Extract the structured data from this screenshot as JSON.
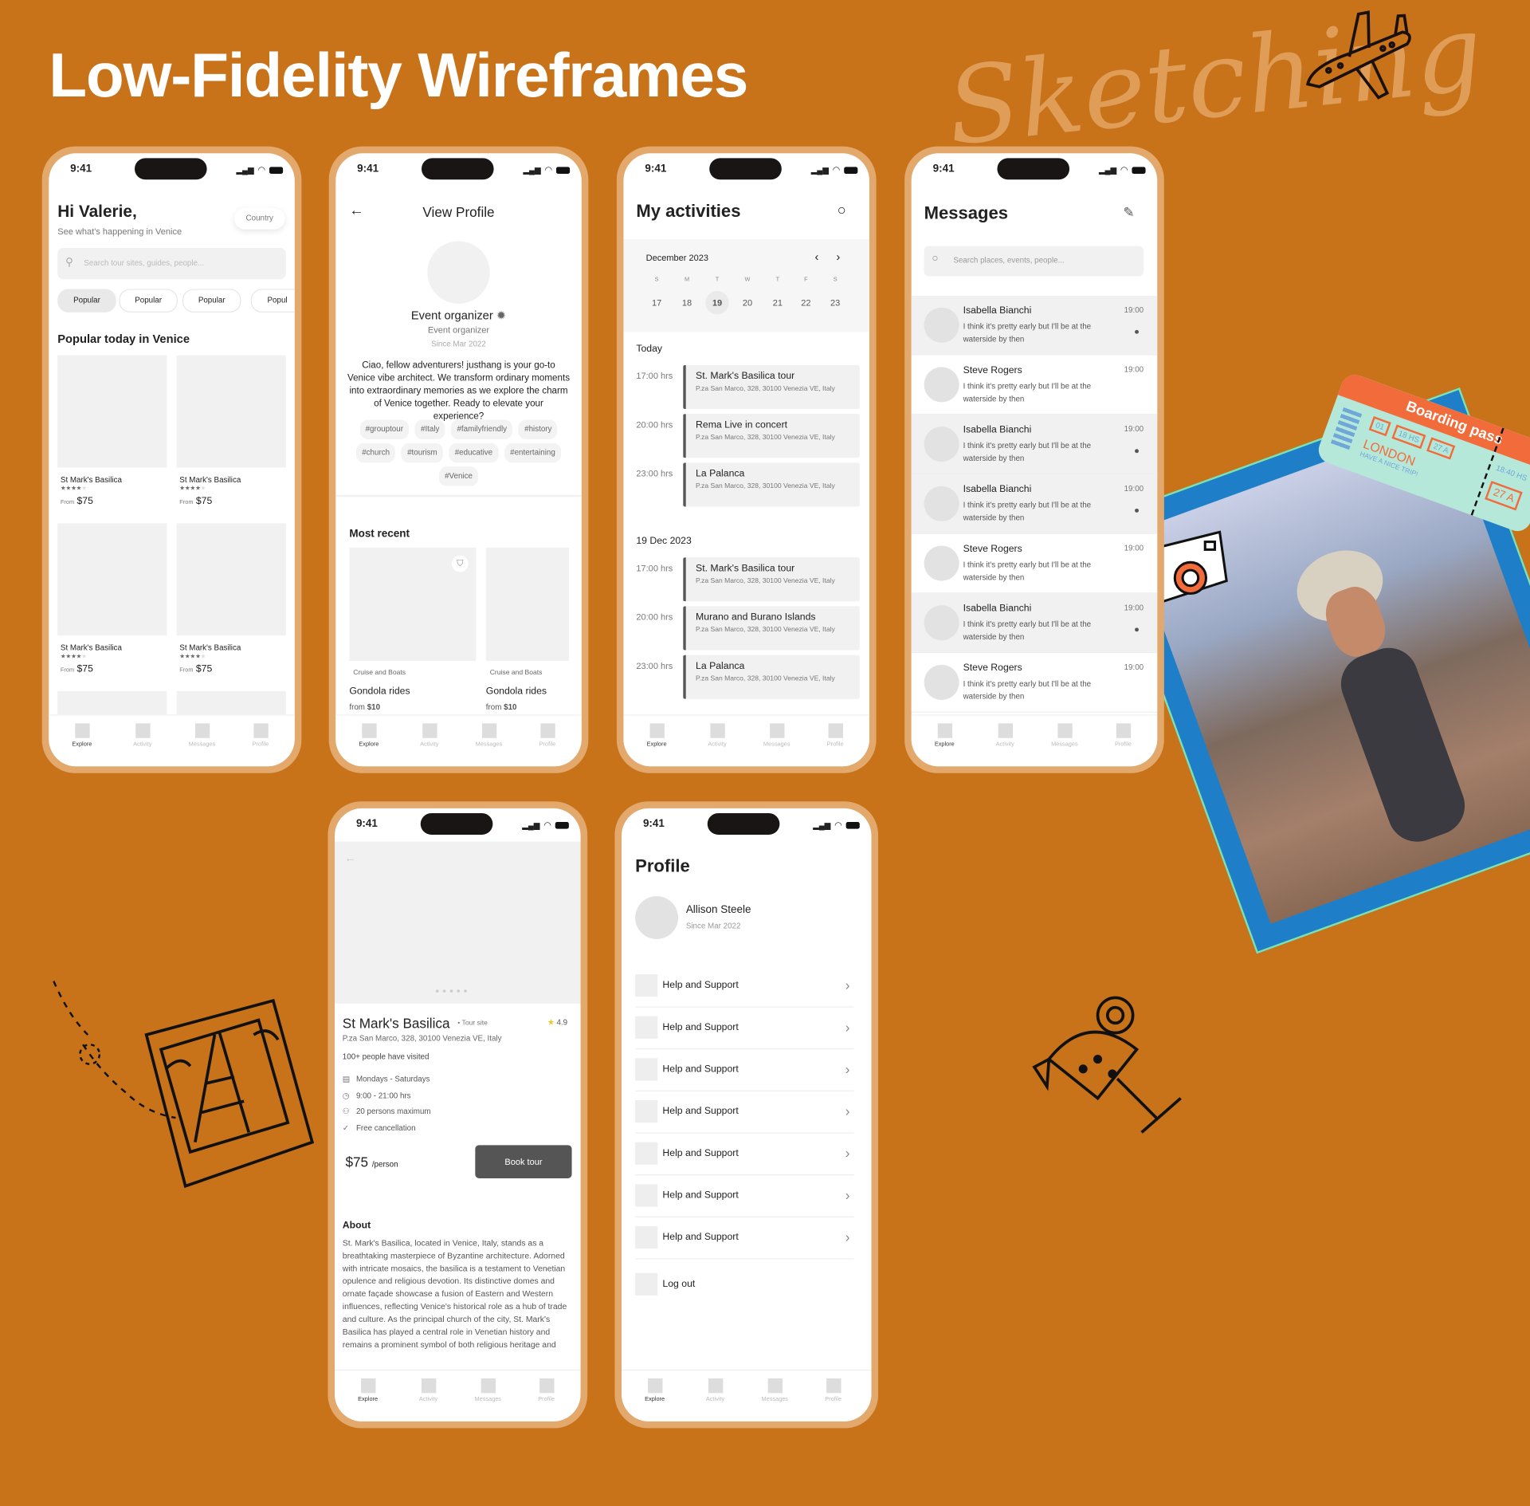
{
  "page": {
    "title": "Low-Fidelity Wireframes",
    "script_title": "Sketching",
    "background": "#C87319"
  },
  "status": {
    "time": "9:41"
  },
  "tabs": [
    "Explore",
    "Activity",
    "Messages",
    "Profile"
  ],
  "home": {
    "greeting": "Hi Valerie,",
    "subtitle": "See  what's happening in Venice",
    "country": "Country",
    "search_placeholder": "Search tour sites, guides, people...",
    "chips": [
      "Popular",
      "Popular",
      "Popular",
      "Popul"
    ],
    "section": "Popular today in Venice",
    "cards": [
      {
        "name": "St Mark's Basilica",
        "from": "From",
        "price": "$75",
        "rating": 4
      },
      {
        "name": "St Mark's Basilica",
        "from": "From",
        "price": "$75",
        "rating": 4
      },
      {
        "name": "St Mark's Basilica",
        "from": "From",
        "price": "$75",
        "rating": 4
      },
      {
        "name": "St Mark's Basilica",
        "from": "From",
        "price": "$75",
        "rating": 4
      }
    ]
  },
  "view_profile": {
    "title": "View Profile",
    "name": "Event organizer",
    "role": "Event organizer",
    "since": "Since Mar 2022",
    "bio": "Ciao, fellow adventurers! justhang is your go-to Venice vibe architect. We transform ordinary moments into extraordinary memories as we explore the charm of Venice together. Ready to elevate your experience?",
    "tags": [
      "#grouptour",
      "#Italy",
      "#familyfriendly",
      "#history",
      "#church",
      "#tourism",
      "#educative",
      "#entertaining",
      "#Venice"
    ],
    "recent_title": "Most recent",
    "recent": [
      {
        "category": "Cruise and Boats",
        "name": "Gondola rides",
        "from": "from",
        "price": "$10"
      },
      {
        "category": "Cruise and Boats",
        "name": "Gondola rides",
        "from": "from",
        "price": "$10"
      }
    ]
  },
  "activities": {
    "title": "My activities",
    "month": "December 2023",
    "weekdays": [
      "S",
      "M",
      "T",
      "W",
      "T",
      "F",
      "S"
    ],
    "dates": [
      "17",
      "18",
      "19",
      "20",
      "21",
      "22",
      "23"
    ],
    "selected_date": "19",
    "groups": [
      {
        "label": "Today",
        "events": [
          {
            "time": "17:00 hrs",
            "name": "St. Mark's Basilica tour",
            "address": "P.za San Marco, 328, 30100 Venezia VE, Italy"
          },
          {
            "time": "20:00 hrs",
            "name": "Rema Live in concert",
            "address": "P.za San Marco, 328, 30100 Venezia VE, Italy"
          },
          {
            "time": "23:00 hrs",
            "name": "La Palanca",
            "address": "P.za San Marco, 328, 30100 Venezia VE, Italy"
          }
        ]
      },
      {
        "label": "19 Dec 2023",
        "events": [
          {
            "time": "17:00 hrs",
            "name": "St. Mark's Basilica tour",
            "address": "P.za San Marco, 328, 30100 Venezia VE, Italy"
          },
          {
            "time": "20:00 hrs",
            "name": "Murano and Burano Islands",
            "address": "P.za San Marco, 328, 30100 Venezia VE, Italy"
          },
          {
            "time": "23:00 hrs",
            "name": "La Palanca",
            "address": "P.za San Marco, 328, 30100 Venezia VE, Italy"
          }
        ]
      }
    ]
  },
  "messages": {
    "title": "Messages",
    "search_placeholder": "Search places, events, people...",
    "items": [
      {
        "name": "Isabella Bianchi",
        "text": "I think it's pretty early but I'll be at the waterside by then",
        "time": "19:00",
        "unread": true
      },
      {
        "name": "Steve Rogers",
        "text": "I think it's pretty early but I'll be at the waterside by then",
        "time": "19:00",
        "unread": false
      },
      {
        "name": "Isabella Bianchi",
        "text": "I think it's pretty early but I'll be at the waterside by then",
        "time": "19:00",
        "unread": true
      },
      {
        "name": "Isabella Bianchi",
        "text": "I think it's pretty early but I'll be at the waterside by then",
        "time": "19:00",
        "unread": true
      },
      {
        "name": "Steve Rogers",
        "text": "I think it's pretty early but I'll be at the waterside by then",
        "time": "19:00",
        "unread": false
      },
      {
        "name": "Isabella Bianchi",
        "text": "I think it's pretty early but I'll be at the waterside by then",
        "time": "19:00",
        "unread": true
      },
      {
        "name": "Steve Rogers",
        "text": "I think it's pretty early but I'll be at the waterside by then",
        "time": "19:00",
        "unread": false
      }
    ]
  },
  "detail": {
    "name": "St Mark's Basilica",
    "type": "Tour site",
    "rating": "4.9",
    "address": "P.za San Marco, 328, 30100 Venezia VE, Italy",
    "visited": "100+ people have visited",
    "info": [
      {
        "icon": "calendar-icon",
        "text": "Mondays - Saturdays"
      },
      {
        "icon": "clock-icon",
        "text": "9:00 - 21:00 hrs"
      },
      {
        "icon": "people-icon",
        "text": "20 persons maximum"
      },
      {
        "icon": "check-circle-icon",
        "text": "Free cancellation"
      }
    ],
    "price": "$75",
    "per": "/person",
    "book": "Book tour",
    "about_title": "About",
    "about": "St. Mark's Basilica, located in Venice, Italy, stands as a breathtaking masterpiece of Byzantine architecture. Adorned with intricate mosaics, the basilica is a testament to Venetian opulence and religious devotion. Its distinctive domes and ornate façade showcase a fusion of Eastern and Western influences, reflecting Venice's historical role as a hub of trade and culture. As the principal church of the city, St. Mark's Basilica has played a central role in Venetian history and remains a prominent symbol of both religious heritage and"
  },
  "profile": {
    "title": "Profile",
    "name": "Allison Steele",
    "since": "Since Mar 2022",
    "items": [
      "Help and Support",
      "Help and Support",
      "Help and Support",
      "Help and Support",
      "Help and Support",
      "Help and Support",
      "Help and Support"
    ],
    "logout": "Log out"
  },
  "ticket": {
    "title": "Boarding pass",
    "city": "LONDON",
    "message": "HAVE A NICE TRIP!",
    "boxes": [
      "01",
      "18 HS",
      "27 A"
    ],
    "stub_time": "18:40 HS",
    "stub_seat": "27 A"
  }
}
